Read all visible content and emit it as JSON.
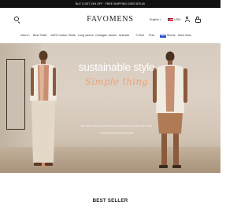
{
  "promo_bar": {
    "text": "BUY 3 GET 15% OFF  ·  FREE SHIPPING OVER $79.00"
  },
  "header": {
    "logo": "FAVOMENS",
    "language": "English",
    "currency": "USD",
    "icons": [
      "search-icon",
      "us-flag-icon",
      "account-icon",
      "cart-icon"
    ]
  },
  "nav": {
    "items": [
      "New In",
      "Best Seller",
      "100% Cotton Shirts",
      "Long sleeve",
      "Cardigan Jacket",
      "Animals",
      "T-Shirt",
      "Polo",
      "Shorts",
      "More links"
    ],
    "sale_badge": "SALE"
  },
  "hero": {
    "headline": "sustainable style",
    "script": "Simple thing",
    "tagline_1": "We want to reduce unconscious fine & necessarily in product with Simple",
    "tagline_2": "To take & brands and doing simple"
  },
  "section": {
    "title": "BEST SELLER"
  },
  "colors": {
    "accent": "#1f4fcc",
    "script_accent": "#e9a57a",
    "promo_bg": "#111111"
  }
}
